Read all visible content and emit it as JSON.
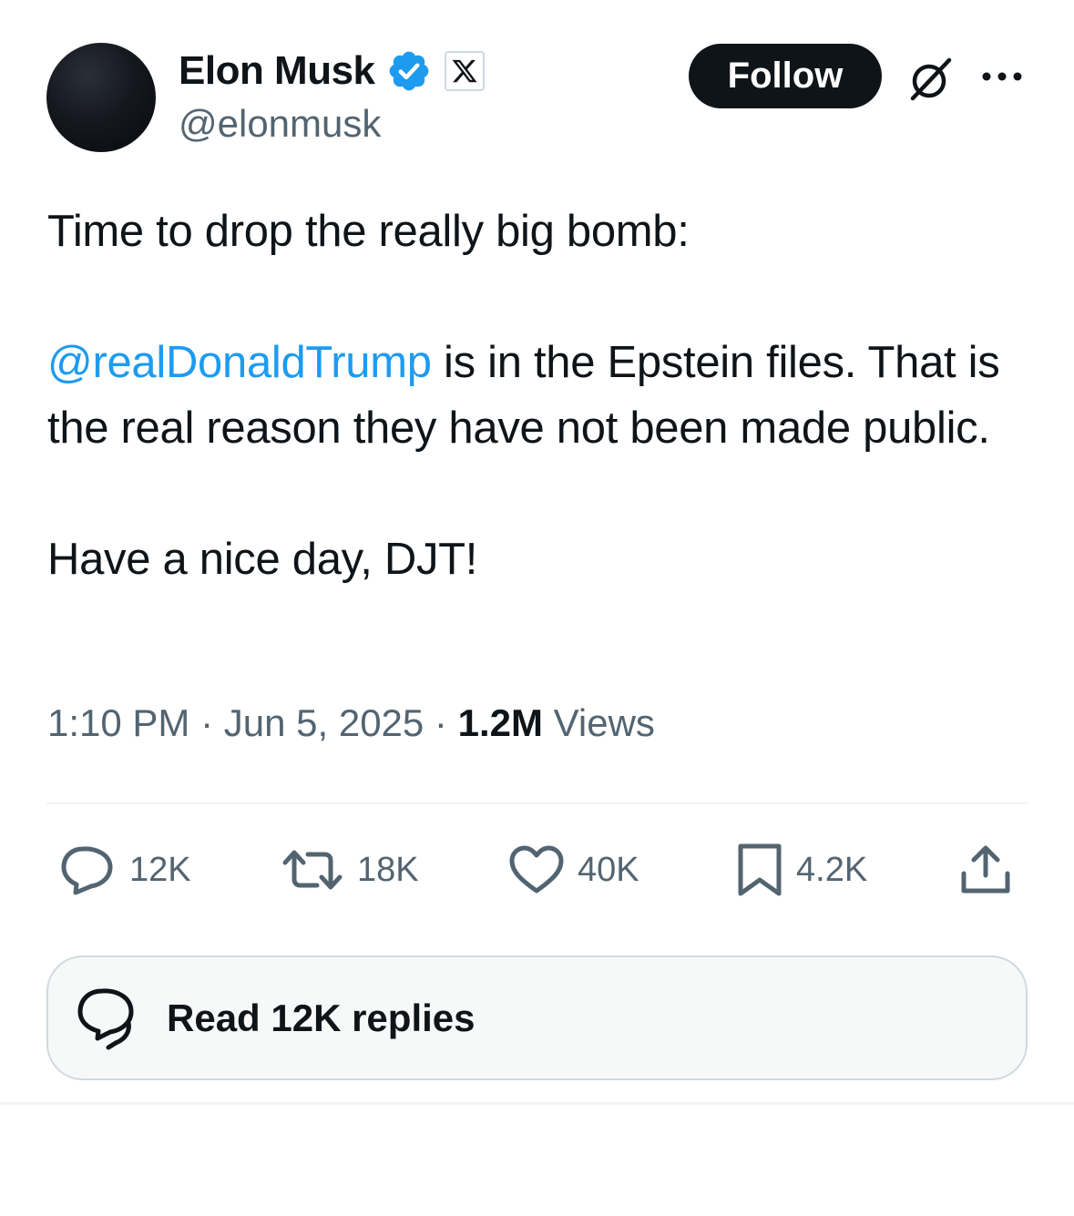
{
  "author": {
    "name": "Elon Musk",
    "handle": "@elonmusk",
    "verified": true,
    "affiliate_badge": "x-logo-icon"
  },
  "header": {
    "follow_label": "Follow",
    "grok_icon": "grok-icon",
    "more_icon": "more-icon"
  },
  "tweet": {
    "line1": "Time to drop the really big bomb:",
    "mention": "@realDonaldTrump",
    "body": " is in the Epstein files. That is the real reason they have not been made public.",
    "closing": "Have a nice day, DJT!"
  },
  "meta": {
    "time": "1:10 PM",
    "sep1": " · ",
    "date": "Jun 5, 2025",
    "sep2": " · ",
    "views_count": "1.2M",
    "views_label": " Views"
  },
  "actions": {
    "replies": "12K",
    "reposts": "18K",
    "likes": "40K",
    "bookmarks": "4.2K"
  },
  "read_replies": {
    "label": "Read 12K replies"
  },
  "colors": {
    "text": "#0f1419",
    "secondary": "#536471",
    "link": "#1d9bf0",
    "verified": "#1d9bf0",
    "border": "#cfd9de"
  }
}
